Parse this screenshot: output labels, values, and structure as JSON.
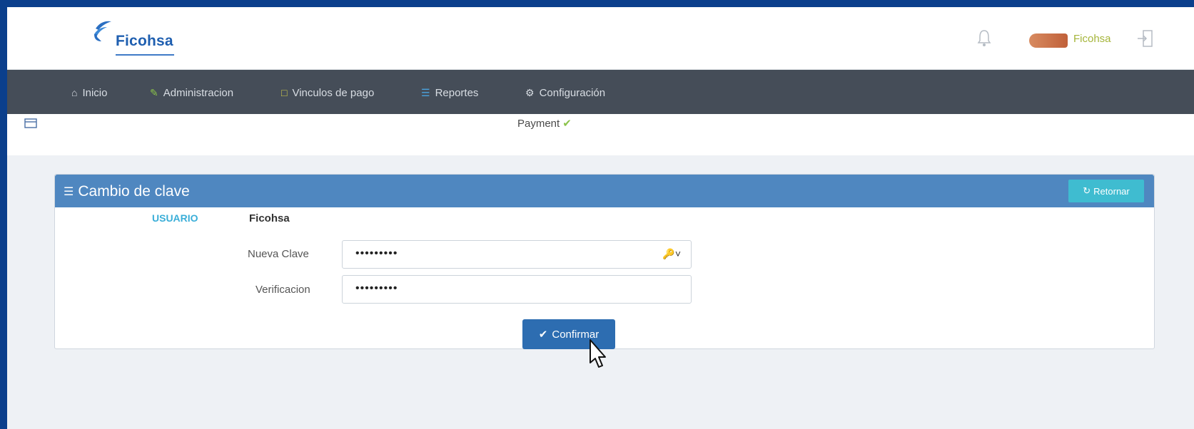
{
  "brand": {
    "name": "Ficohsa"
  },
  "header": {
    "user_name": "Ficohsa"
  },
  "nav": {
    "items": [
      {
        "label": "Inicio",
        "icon": "home-icon"
      },
      {
        "label": "Administracion",
        "icon": "pencil-icon"
      },
      {
        "label": "Vinculos de pago",
        "icon": "document-icon"
      },
      {
        "label": "Reportes",
        "icon": "list-icon"
      },
      {
        "label": "Configuración",
        "icon": "gear-icon"
      }
    ]
  },
  "substrip": {
    "payment_label": "Payment"
  },
  "panel": {
    "title": "Cambio de clave",
    "return_label": "Retornar",
    "user_label": "USUARIO",
    "user_value": "Ficohsa",
    "new_password_label": "Nueva Clave",
    "new_password_value": "•••••••••",
    "verification_label": "Verificacion",
    "verification_value": "•••••••••",
    "confirm_label": "Confirmar"
  },
  "colors": {
    "panel_header": "#4f87c0",
    "navbar": "#454d58",
    "confirm_button": "#2d6db1",
    "return_button": "#3fbcd0",
    "user_label": "#3aaed8"
  }
}
